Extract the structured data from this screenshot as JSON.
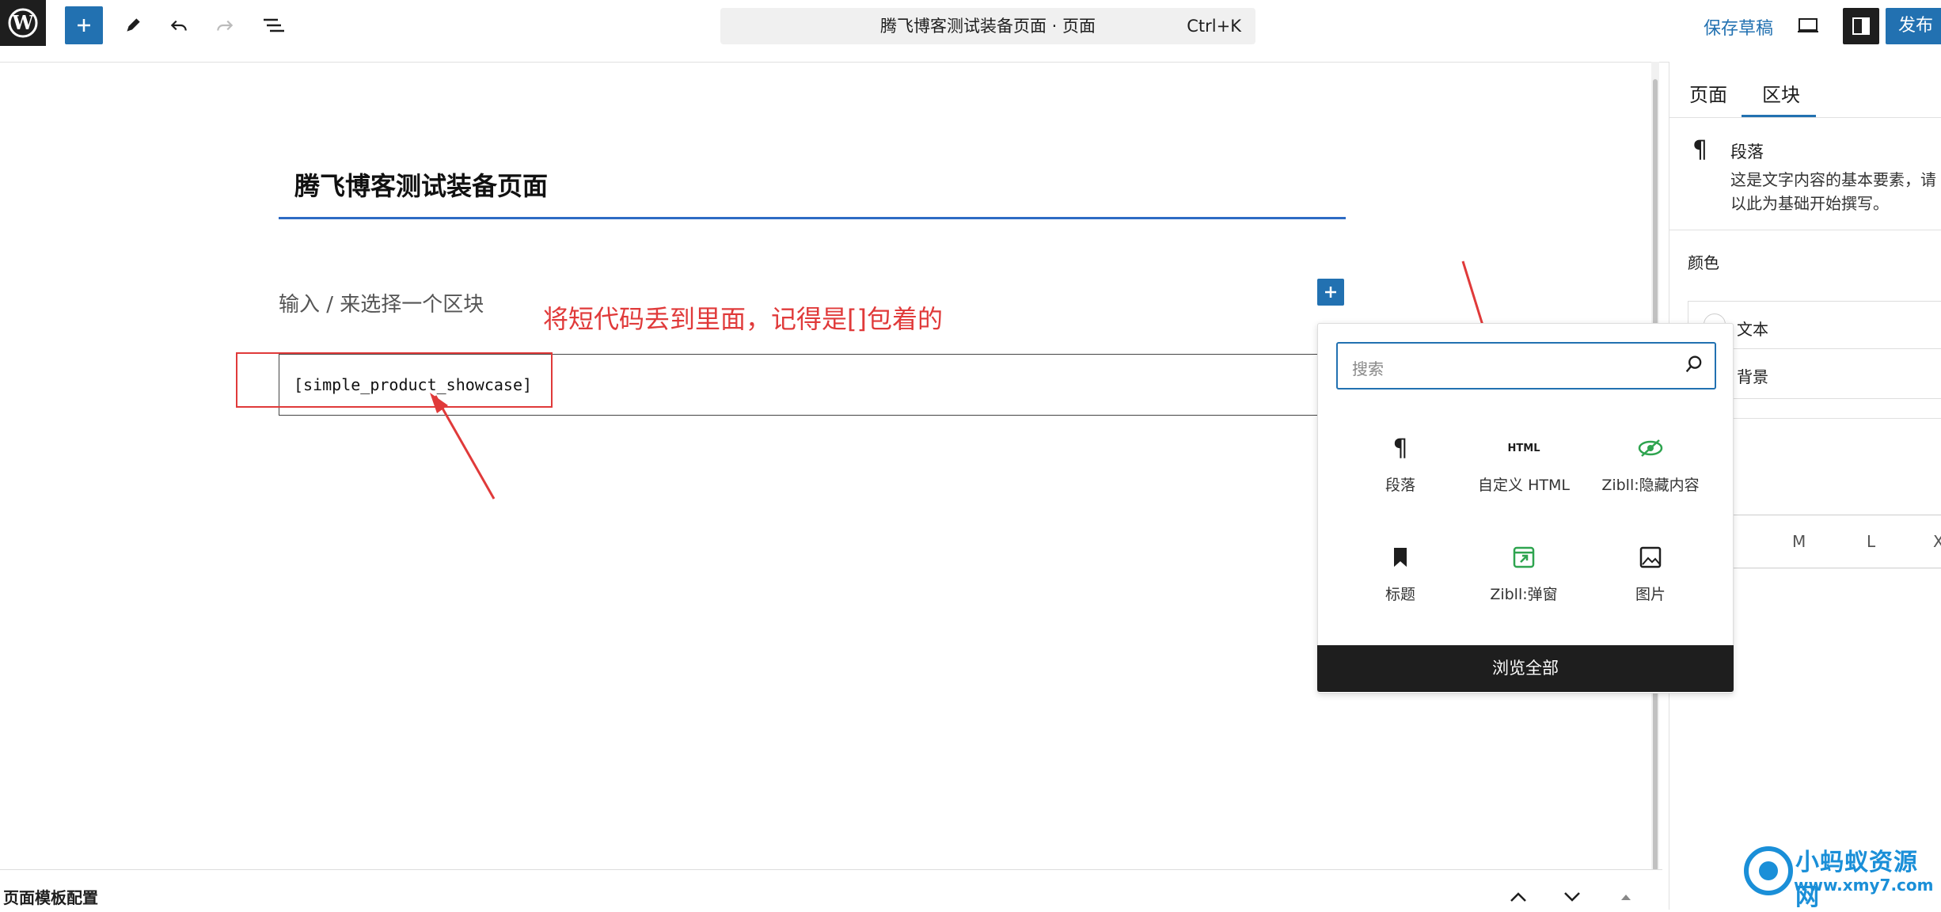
{
  "topbar": {
    "command_title": "腾飞博客测试装备页面 · 页面",
    "command_shortcut": "Ctrl+K",
    "save_draft": "保存草稿",
    "publish": "发布"
  },
  "editor": {
    "page_title": "腾飞博客测试装备页面",
    "placeholder": "输入 / 来选择一个区块",
    "shortcode": "[simple_product_showcase]",
    "annotation": "将短代码丢到里面，记得是[]包着的"
  },
  "inserter": {
    "search_placeholder": "搜索",
    "blocks": [
      {
        "label": "段落",
        "icon": "paragraph-icon"
      },
      {
        "label": "自定义 HTML",
        "icon": "html-icon"
      },
      {
        "label": "Zibll:隐藏内容",
        "icon": "eye-slash-icon"
      },
      {
        "label": "标题",
        "icon": "bookmark-icon"
      },
      {
        "label": "Zibll:弹窗",
        "icon": "popup-icon"
      },
      {
        "label": "图片",
        "icon": "image-icon"
      }
    ],
    "html_icon_text": "HTML",
    "browse_all": "浏览全部"
  },
  "sidebar": {
    "tab_page": "页面",
    "tab_block": "区块",
    "block_name": "段落",
    "block_desc": "这是文字内容的基本要素，请以此为基础开始撰写。",
    "color_label": "颜色",
    "color_text": "文本",
    "color_bg": "背景",
    "sizes": [
      "M",
      "L",
      "X"
    ]
  },
  "bottom": {
    "label": "页面模板配置"
  },
  "watermark": {
    "line1": "小蚂蚁资源网",
    "line2": "www.xmy7.com"
  },
  "colors": {
    "accent": "#2271b1",
    "annotation": "#e03a3a",
    "zibll_green": "#2ea44f"
  }
}
